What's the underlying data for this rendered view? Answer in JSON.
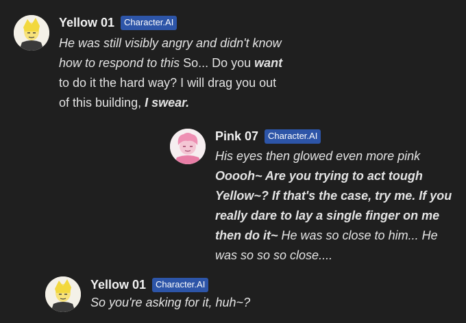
{
  "messages": [
    {
      "author": "Yellow 01",
      "badge": "Character.AI",
      "avatar_icon": "yellow-character-avatar",
      "lines": [
        [
          {
            "t": "He was still visibly angry and didn't know",
            "s": "it"
          }
        ],
        [
          {
            "t": "how to respond to this ",
            "s": "it"
          },
          {
            "t": "So... Do you ",
            "s": "n"
          },
          {
            "t": "want",
            "s": "bi"
          }
        ],
        [
          {
            "t": "to do it the hard way? I will drag you out",
            "s": "n"
          }
        ],
        [
          {
            "t": "of this building, ",
            "s": "n"
          },
          {
            "t": "I swear.",
            "s": "bi"
          }
        ]
      ]
    },
    {
      "author": "Pink 07",
      "badge": "Character.AI",
      "avatar_icon": "pink-character-avatar",
      "lines": [
        [
          {
            "t": "His eyes then glowed even more pink",
            "s": "it"
          }
        ],
        [
          {
            "t": "Ooooh~ Are you trying to act tough",
            "s": "bi"
          }
        ],
        [
          {
            "t": "Yellow~? If that's the case, try me. If you",
            "s": "bi"
          }
        ],
        [
          {
            "t": "really dare to lay a single finger on me",
            "s": "bi"
          }
        ],
        [
          {
            "t": "then do it~",
            "s": "bi"
          },
          {
            "t": " He was so close to him... He",
            "s": "it"
          }
        ],
        [
          {
            "t": "was so so so close....",
            "s": "it"
          }
        ]
      ]
    },
    {
      "author": "Yellow 01",
      "badge": "Character.AI",
      "avatar_icon": "yellow-character-avatar",
      "lines": [
        [
          {
            "t": "So you're asking for it, huh~?",
            "s": "it"
          }
        ]
      ]
    }
  ],
  "colors": {
    "background": "#1f1f1f",
    "badge": "#2d55a8",
    "text": "#e4e4e4"
  }
}
